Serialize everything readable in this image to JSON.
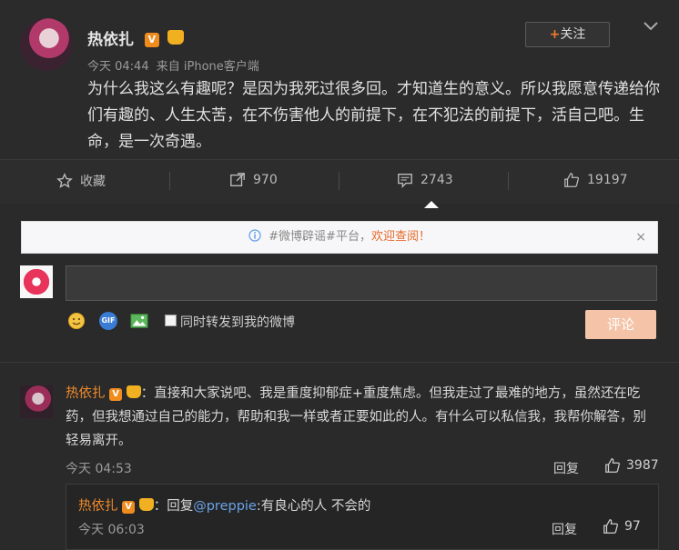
{
  "post": {
    "username": "热依扎",
    "v_badge": "V",
    "time": "今天 04:44",
    "source": "来自 iPhone客户端",
    "content": "为什么我这么有趣呢？是因为我死过很多回。才知道生的意义。所以我愿意传递给你们有趣的、人生太苦，在不伤害他人的前提下，在不犯法的前提下，活自己吧。生命，是一次奇遇。",
    "follow_plus": "+",
    "follow_label": "关注"
  },
  "actions": {
    "favorite": "收藏",
    "repost_count": "970",
    "comment_count": "2743",
    "like_count": "19197"
  },
  "notice": {
    "text_part1": "#微博辟谣#平台，",
    "text_part2": "欢迎查阅！",
    "close": "×"
  },
  "composer": {
    "sync_label": "同时转发到我的微博",
    "submit_label": "评论",
    "gif_label": "GIF"
  },
  "comments": [
    {
      "username": "热依扎",
      "v_badge": "V",
      "separator": "：",
      "text": "直接和大家说吧、我是重度抑郁症+重度焦虑。但我走过了最难的地方，虽然还在吃药，但我想通过自己的能力，帮助和我一样或者正要如此的人。有什么可以私信我，我帮你解答，别轻易离开。",
      "time": "今天 04:53",
      "reply_label": "回复",
      "like_count": "3987"
    }
  ],
  "sub_reply": {
    "username": "热依扎",
    "v_badge": "V",
    "prefix": "：回复",
    "mention": "@preppie",
    "text": ":有良心的人 不会的",
    "time": "今天 06:03",
    "reply_label": "回复",
    "like_count": "97"
  },
  "colors": {
    "background": "#2a2a2a",
    "accent_orange": "#f08a2a",
    "mention_blue": "#6aa3e8",
    "submit_disabled": "#f5c4a8"
  }
}
